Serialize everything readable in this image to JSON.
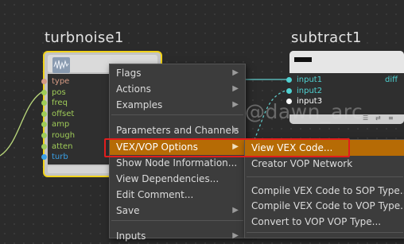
{
  "nodes": {
    "turbnoise": {
      "title": "turbnoise1",
      "ports": [
        {
          "name": "type",
          "color": "#d59a84"
        },
        {
          "name": "pos",
          "color": "#9fcb58"
        },
        {
          "name": "freq",
          "color": "#9fcb58"
        },
        {
          "name": "offset",
          "color": "#9fcb58"
        },
        {
          "name": "amp",
          "color": "#9fcb58"
        },
        {
          "name": "rough",
          "color": "#9fcb58"
        },
        {
          "name": "atten",
          "color": "#9fcb58"
        },
        {
          "name": "turb",
          "color": "#3aa0e6"
        }
      ]
    },
    "subtract": {
      "title": "subtract1",
      "inputs": [
        {
          "name": "input1",
          "color": "#4fd1d1"
        },
        {
          "name": "input2",
          "color": "#4fd1d1"
        },
        {
          "name": "input3",
          "color": "#ffffff"
        }
      ],
      "output": "diff",
      "output_color": "#4fd1d1",
      "footer_glyphs": [
        "☰",
        "⇄",
        "≡"
      ]
    }
  },
  "context_menu": {
    "items": [
      {
        "label": "Flags",
        "submenu": true
      },
      {
        "label": "Actions",
        "submenu": true
      },
      {
        "label": "Examples",
        "submenu": true
      },
      {
        "label": "Parameters and Channels",
        "submenu": true
      },
      {
        "label": "VEX/VOP Options",
        "submenu": true,
        "highlighted": true
      },
      {
        "label": "Show Node Information...",
        "submenu": false
      },
      {
        "label": "View Dependencies...",
        "submenu": false
      },
      {
        "label": "Edit Comment...",
        "submenu": false
      },
      {
        "label": "Save",
        "submenu": true
      },
      {
        "label": "Inputs",
        "submenu": true
      }
    ]
  },
  "submenu": {
    "items": [
      {
        "label": "View VEX Code...",
        "highlighted": true
      },
      {
        "label": "Creator VOP Network"
      },
      {
        "label": "Compile VEX Code to SOP Type..."
      },
      {
        "label": "Compile VEX Code to VOP Type..."
      },
      {
        "label": "Convert to VOP VOP Type..."
      }
    ]
  },
  "watermark": "@dawn_arc",
  "colors": {
    "highlight": "#b66b05",
    "selection_border": "#f0d21a",
    "annotation_outline": "#e11d1d"
  }
}
